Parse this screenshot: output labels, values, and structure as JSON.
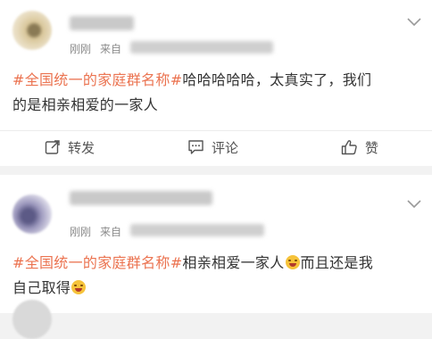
{
  "posts": [
    {
      "time": "刚刚",
      "source_prefix": "来自",
      "hashtag": "#全国统一的家庭群名称#",
      "body_line1": "哈哈哈哈哈，太真实了，我们",
      "body_line2": "的是相亲相爱的一家人",
      "actions": {
        "repost": "转发",
        "comment": "评论",
        "like": "赞"
      }
    },
    {
      "time": "刚刚",
      "source_prefix": "来自",
      "hashtag": "#全国统一的家庭群名称#",
      "body_line1_a": "相亲相爱一家人",
      "body_line1_b": "而且还是我",
      "body_line2": "自己取得"
    }
  ],
  "icons": [
    "repost-icon",
    "comment-icon",
    "like-icon",
    "chevron-down-icon",
    "laughing-emoji"
  ],
  "colors": {
    "hashtag": "#eb7350",
    "text": "#333333",
    "meta": "#8a8a8a",
    "separator": "#f2f2f2"
  }
}
